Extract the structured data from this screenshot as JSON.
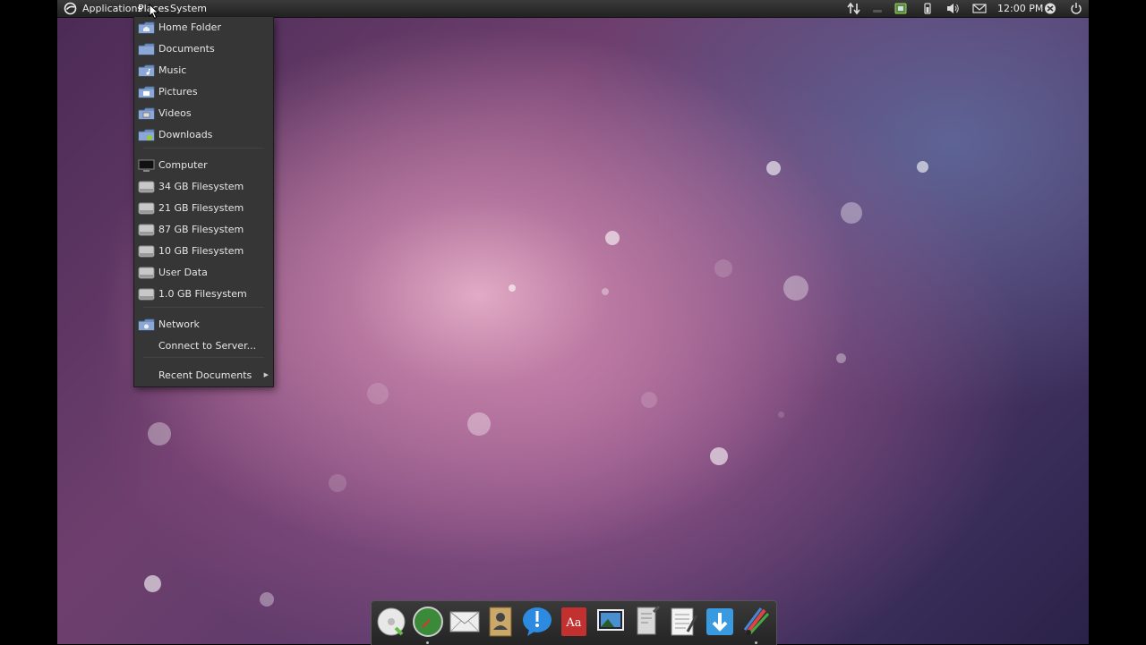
{
  "top_panel": {
    "menus": [
      "Applications",
      "Places",
      "System"
    ],
    "clock": "12:00 PM"
  },
  "places_menu": {
    "items": [
      {
        "label": "Home Folder",
        "icon": "home-folder-icon"
      },
      {
        "label": "Documents",
        "icon": "folder-icon"
      },
      {
        "label": "Music",
        "icon": "music-folder-icon"
      },
      {
        "label": "Pictures",
        "icon": "pictures-folder-icon"
      },
      {
        "label": "Videos",
        "icon": "videos-folder-icon"
      },
      {
        "label": "Downloads",
        "icon": "downloads-folder-icon"
      },
      {
        "label": "Computer",
        "icon": "computer-icon"
      },
      {
        "label": "34 GB Filesystem",
        "icon": "drive-icon"
      },
      {
        "label": "21 GB Filesystem",
        "icon": "drive-icon"
      },
      {
        "label": "87 GB Filesystem",
        "icon": "drive-icon"
      },
      {
        "label": "10 GB Filesystem",
        "icon": "drive-icon"
      },
      {
        "label": "User Data",
        "icon": "drive-icon"
      },
      {
        "label": "1.0 GB Filesystem",
        "icon": "drive-icon"
      },
      {
        "label": "Network",
        "icon": "network-folder-icon"
      },
      {
        "label": "Connect to Server...",
        "icon": ""
      },
      {
        "label": "Recent Documents",
        "icon": "",
        "submenu": true
      }
    ]
  },
  "dock": {
    "items": [
      "disc-burner-icon",
      "browser-compass-icon",
      "mail-icon",
      "contacts-icon",
      "chat-icon",
      "dictionary-icon",
      "image-viewer-icon",
      "text-editor-icon",
      "notepad-icon",
      "download-manager-icon",
      "paint-icon"
    ]
  },
  "colors": {
    "panel": "#2a2a2a",
    "menu_bg": "#363636",
    "folder_blue": "#6f8fc0"
  }
}
